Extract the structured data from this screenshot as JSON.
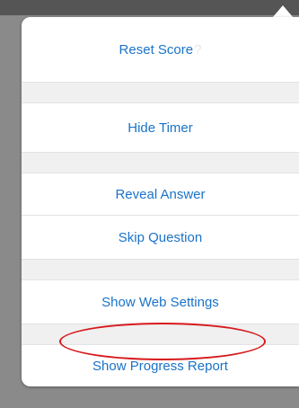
{
  "menu": {
    "reset_score": "Reset Score",
    "reset_help": "?",
    "hide_timer": "Hide Timer",
    "reveal_answer": "Reveal Answer",
    "skip_question": "Skip Question",
    "show_web_settings": "Show Web Settings",
    "show_progress_report": "Show Progress Report"
  },
  "icons": {
    "help": "question-mark-icon"
  },
  "colors": {
    "link": "#1a73c8",
    "annotation": "#d8191c",
    "backdrop": "#8a8a8a"
  }
}
